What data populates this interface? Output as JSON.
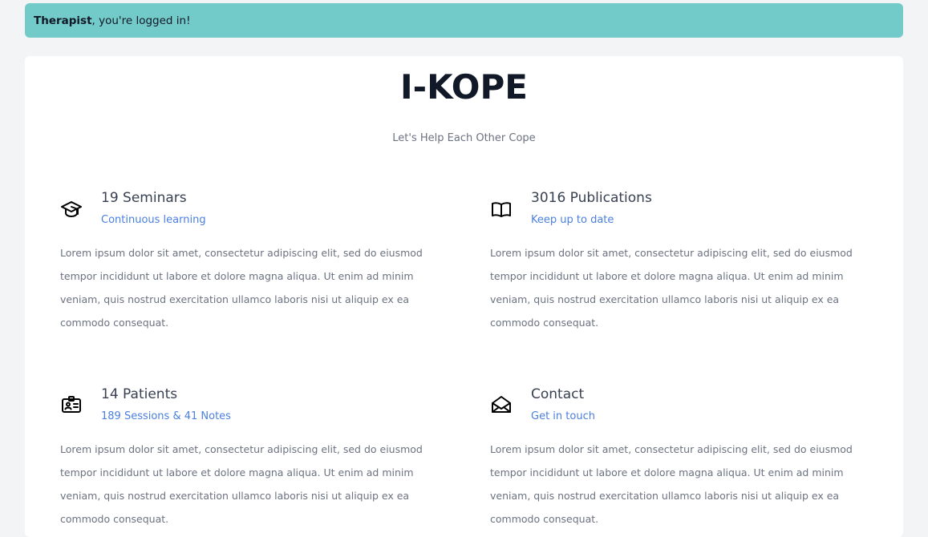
{
  "alert": {
    "role": "Therapist",
    "message": ", you're logged in!"
  },
  "header": {
    "title": "I-KOPE",
    "subtitle": "Let's Help Each Other Cope"
  },
  "features": [
    {
      "icon": "graduation-cap-icon",
      "heading": "19 Seminars",
      "subheading": "Continuous learning",
      "body": "Lorem ipsum dolor sit amet, consectetur adipiscing elit, sed do eiusmod tempor incididunt ut labore et dolore magna aliqua. Ut enim ad minim veniam, quis nostrud exercitation ullamco laboris nisi ut aliquip ex ea commodo consequat."
    },
    {
      "icon": "open-book-icon",
      "heading": "3016 Publications",
      "subheading": "Keep up to date",
      "body": "Lorem ipsum dolor sit amet, consectetur adipiscing elit, sed do eiusmod tempor incididunt ut labore et dolore magna aliqua. Ut enim ad minim veniam, quis nostrud exercitation ullamco laboris nisi ut aliquip ex ea commodo consequat."
    },
    {
      "icon": "id-badge-icon",
      "heading": "14 Patients",
      "subheading": "189 Sessions & 41 Notes",
      "body": "Lorem ipsum dolor sit amet, consectetur adipiscing elit, sed do eiusmod tempor incididunt ut labore et dolore magna aliqua. Ut enim ad minim veniam, quis nostrud exercitation ullamco laboris nisi ut aliquip ex ea commodo consequat."
    },
    {
      "icon": "envelope-open-icon",
      "heading": "Contact",
      "subheading": "Get in touch",
      "body": "Lorem ipsum dolor sit amet, consectetur adipiscing elit, sed do eiusmod tempor incididunt ut labore et dolore magna aliqua. Ut enim ad minim veniam, quis nostrud exercitation ullamco laboris nisi ut aliquip ex ea commodo consequat."
    }
  ]
}
